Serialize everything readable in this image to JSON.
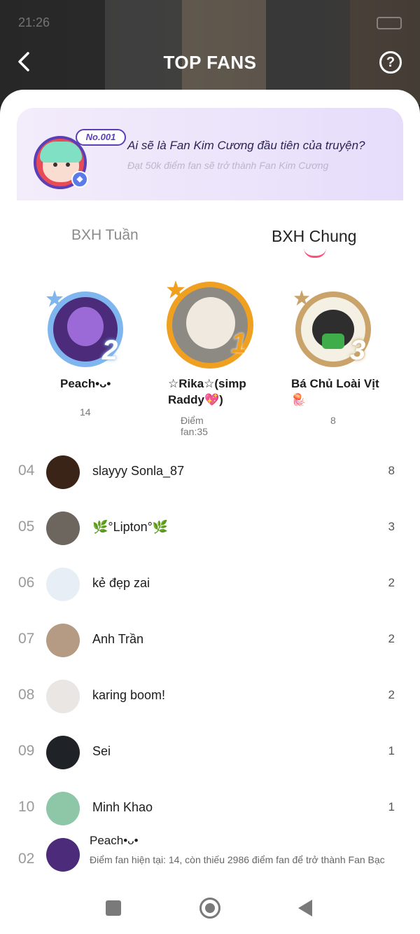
{
  "status_bar": {
    "time": "21:26"
  },
  "header": {
    "title": "TOP FANS",
    "help_label": "?"
  },
  "banner": {
    "tag": "No.001",
    "title": "Ai sẽ là Fan Kim Cương đầu tiên của truyện?",
    "subtitle": "Đạt 50k điểm fan sẽ trở thành Fan Kim Cương"
  },
  "tabs": [
    {
      "label": "BXH Tuần",
      "active": false
    },
    {
      "label": "BXH Chung",
      "active": true
    }
  ],
  "podium": [
    {
      "rank": "2",
      "name": "Peach•ᴗ•",
      "score": "14"
    },
    {
      "rank": "1",
      "name": "☆Rika☆(simp Raddy💖)",
      "score": "Điểm fan:35"
    },
    {
      "rank": "3",
      "name": "Bá Chủ Loài Vịt 🪼",
      "score": "8"
    }
  ],
  "list": [
    {
      "rank": "04",
      "name": "slayyy Sonla_87",
      "score": "8"
    },
    {
      "rank": "05",
      "name": "🌿°Lipton°🌿",
      "score": "3"
    },
    {
      "rank": "06",
      "name": "kẻ đẹp zai",
      "score": "2"
    },
    {
      "rank": "07",
      "name": "Anh Trần",
      "score": "2"
    },
    {
      "rank": "08",
      "name": "karing boom!",
      "score": "2"
    },
    {
      "rank": "09",
      "name": "Sei",
      "score": "1"
    },
    {
      "rank": "10",
      "name": "Minh Khao",
      "score": "1"
    }
  ],
  "me": {
    "rank": "02",
    "name": "Peach•ᴗ•",
    "description": "Điểm fan hiện tại: 14, còn thiếu 2986 điểm fan để trở thành Fan Bạc"
  },
  "colors": {
    "accent": "#ff4f7a",
    "banner_purple": "#5a3fb6",
    "gold": "#f0a020",
    "silver": "#7fb6f0",
    "bronze": "#c9a36a"
  }
}
